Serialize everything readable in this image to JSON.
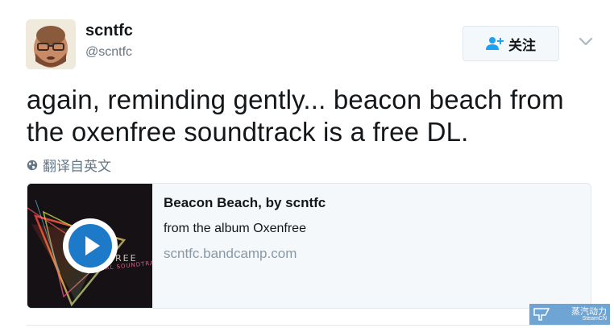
{
  "user": {
    "display_name": "scntfc",
    "handle": "@scntfc"
  },
  "actions": {
    "follow_label": "关注"
  },
  "tweet": {
    "text": "again, reminding gently... beacon beach from the oxenfree soundtrack is a free DL.",
    "translate_label": "翻译自英文"
  },
  "card": {
    "title": "Beacon Beach, by scntfc",
    "description": "from the album Oxenfree",
    "domain": "scntfc.bandcamp.com",
    "art_text": "OXENFREE ORIGINAL SOUNDTRACK"
  },
  "watermark": {
    "main": "蒸汽动力",
    "sub": "SteamCN"
  },
  "colors": {
    "primary_text": "#14171a",
    "secondary_text": "#657786",
    "border": "#e1e8ed",
    "card_bg": "#f5f8fa",
    "play_accent": "#1d7ac9"
  }
}
